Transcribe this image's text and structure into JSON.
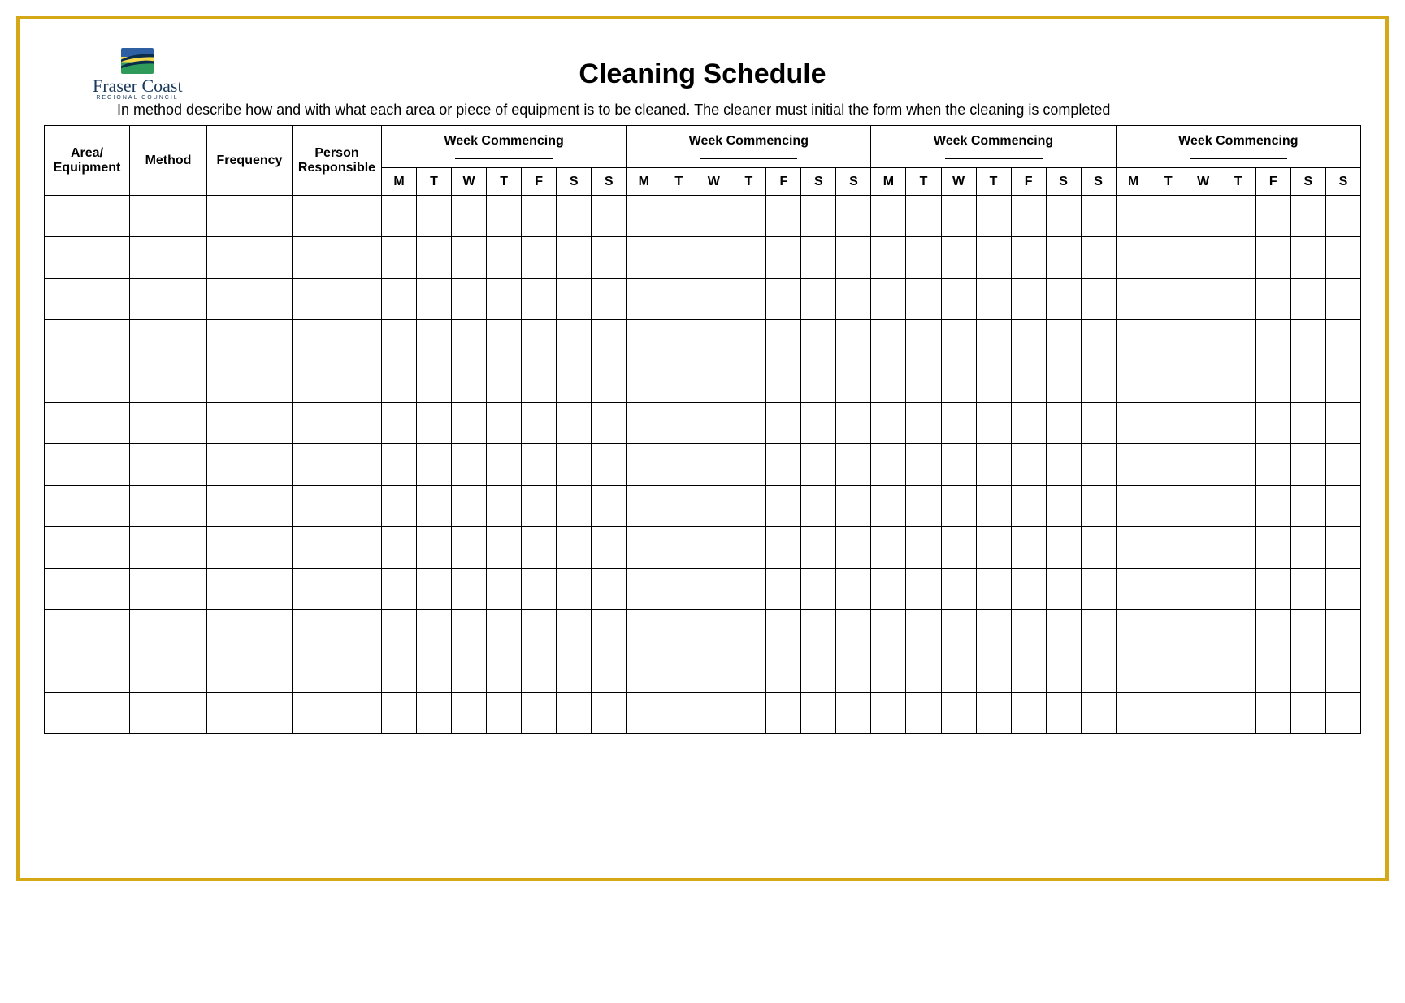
{
  "logo": {
    "name": "Fraser Coast",
    "sub": "REGIONAL COUNCIL"
  },
  "title": "Cleaning Schedule",
  "instructions": "In method describe how and with what each area or piece of equipment is to be cleaned. The cleaner  must initial the form when the cleaning is completed",
  "columns": {
    "area": "Area/ Equipment",
    "method": "Method",
    "frequency": "Frequency",
    "person": "Person Responsible",
    "week_commencing": "Week Commencing"
  },
  "days": [
    "M",
    "T",
    "W",
    "T",
    "F",
    "S",
    "S"
  ],
  "week_count": 4,
  "body_row_count": 13
}
